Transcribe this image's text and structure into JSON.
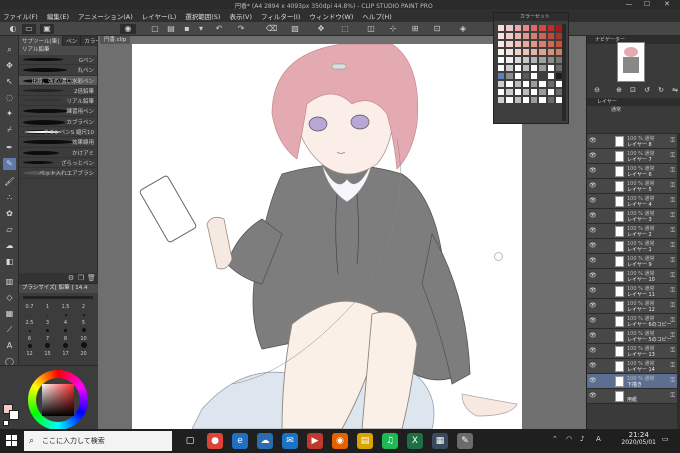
{
  "window": {
    "title": "円香* (A4 2894 x 4093px 350dpi 44.8%)  - CLIP STUDIO PAINT PRO",
    "minimize": "—",
    "maximize": "☐",
    "close": "✕"
  },
  "menu": [
    "ファイル(F)",
    "編集(E)",
    "アニメーション(A)",
    "レイヤー(L)",
    "選択範囲(S)",
    "表示(V)",
    "フィルター(I)",
    "ウィンドウ(W)",
    "ヘルプ(H)"
  ],
  "subtool": {
    "tabs": [
      "サブツール[筆]",
      "ペン",
      "カラー",
      "鉛筆"
    ],
    "header": "リアル鉛筆",
    "brushes": [
      {
        "name": "Gペン"
      },
      {
        "name": "丸ペン"
      },
      {
        "name": "出線、強め/濃い水彩ペン",
        "selected": true
      },
      {
        "name": "2倍鉛筆"
      },
      {
        "name": "リアル鉛筆"
      },
      {
        "name": "練習用ペン"
      },
      {
        "name": "カブラペン"
      },
      {
        "name": "ネオンペンS 縮尺10"
      },
      {
        "name": "効果線用"
      },
      {
        "name": "かけアミ"
      },
      {
        "name": "ざらっとペン"
      },
      {
        "name": "ペット入れエアブラシ"
      }
    ]
  },
  "brushsize": {
    "header": "ブラシサイズ[ 鉛筆 ] 14.4",
    "sizes": [
      "0.7",
      "1",
      "1.5",
      "2",
      "2.5",
      "3",
      "4",
      "5",
      "6",
      "7",
      "8",
      "10",
      "12",
      "15",
      "17",
      "20"
    ]
  },
  "canvas": {
    "doc_tab": "円香.clip"
  },
  "colorset": {
    "title": "カラーセット",
    "chips": [
      "#f6dede",
      "#f1c7c7",
      "#e9a9a9",
      "#e28c8c",
      "#d86a6a",
      "#cf4a4a",
      "#c42a2a",
      "#b01818",
      "#f4e3e0",
      "#eecdc8",
      "#e6b4ad",
      "#de9a92",
      "#d57f76",
      "#cc645a",
      "#c2493e",
      "#a9322a",
      "#f7e9e4",
      "#f2d6cf",
      "#ecc1b7",
      "#e5ac9f",
      "#de9686",
      "#d6806d",
      "#ce6a55",
      "#c4543c",
      "#fbf2ee",
      "#f7e4dc",
      "#f2d4c9",
      "#ecc4b5",
      "#e6b3a1",
      "#dfa28c",
      "#d89177",
      "#d08062",
      "#ffffff",
      "#f0f0f0",
      "#dcdcdc",
      "#c8c8c8",
      "#b4b4b4",
      "#a0a0a0",
      "#8c8c8c",
      "#787878",
      "#ffffff",
      "#cfcfcf",
      "#ffffff",
      "#bdbdbd",
      "#ffffff",
      "#9b9b9b",
      "#ffffff",
      "#6b6b6b",
      "#5d7fb3",
      "#8c8c8c",
      "#ffffff",
      "#5a5a5a",
      "#ffffff",
      "#3d3d3d",
      "#ffffff",
      "#1f1f1f",
      "#cfcfcf",
      "#ffffff",
      "#bdbdbd",
      "#ffffff",
      "#9b9b9b",
      "#ffffff",
      "#6b6b6b",
      "#ffffff",
      "#ffffff",
      "#cfcfcf",
      "#ffffff",
      "#bdbdbd",
      "#ffffff",
      "#9b9b9b",
      "#ffffff",
      "#6b6b6b",
      "#cfcfcf",
      "#ffffff",
      "#bdbdbd",
      "#ffffff",
      "#9b9b9b",
      "#ffffff",
      "#6b6b6b",
      "#ffffff"
    ]
  },
  "rightpanel": {
    "nav_tab": "ナビゲーター",
    "layer_tab": "レイヤー",
    "blend": "通常",
    "opacity": "100"
  },
  "layers": [
    {
      "blend": "100 % 通常",
      "name": "レイヤー 8"
    },
    {
      "blend": "100 % 通常",
      "name": "レイヤー 7"
    },
    {
      "blend": "100 % 通常",
      "name": "レイヤー 6"
    },
    {
      "blend": "100 % 通常",
      "name": "レイヤー 5"
    },
    {
      "blend": "100 % 通常",
      "name": "レイヤー 4"
    },
    {
      "blend": "100 % 通常",
      "name": "レイヤー 3"
    },
    {
      "blend": "100 % 通常",
      "name": "レイヤー 2"
    },
    {
      "blend": "100 % 通常",
      "name": "レイヤー 1"
    },
    {
      "blend": "100 % 通常",
      "name": "レイヤー 9"
    },
    {
      "blend": "100 % 通常",
      "name": "レイヤー 10"
    },
    {
      "blend": "100 % 通常",
      "name": "レイヤー 11"
    },
    {
      "blend": "100 % 通常",
      "name": "レイヤー 12"
    },
    {
      "blend": "100 % 通常",
      "name": "レイヤー 6のコピー"
    },
    {
      "blend": "100 % 通常",
      "name": "レイヤー 5のコピー"
    },
    {
      "blend": "100 % 通常",
      "name": "レイヤー 13"
    },
    {
      "blend": "100 % 通常",
      "name": "レイヤー 14"
    },
    {
      "blend": "100 % 通常",
      "name": "下描き",
      "selected": true
    },
    {
      "blend": "",
      "name": "用紙"
    }
  ],
  "taskbar": {
    "search_placeholder": "ここに入力して検索",
    "time": "21:24",
    "date": "2020/05/01",
    "apps": [
      {
        "icon": "task-view-icon",
        "glyph": "▢",
        "color": "#1f1f1f"
      },
      {
        "icon": "chrome-icon",
        "glyph": "●",
        "color": "#db4437"
      },
      {
        "icon": "edge-icon",
        "glyph": "e",
        "color": "#1f6fc5"
      },
      {
        "icon": "onedrive-icon",
        "glyph": "☁",
        "color": "#2b6cb0"
      },
      {
        "icon": "mail-icon",
        "glyph": "✉",
        "color": "#1a73c7"
      },
      {
        "icon": "media-icon",
        "glyph": "▶",
        "color": "#c0392b"
      },
      {
        "icon": "firefox-icon",
        "glyph": "◉",
        "color": "#e66000"
      },
      {
        "icon": "folder-icon",
        "glyph": "▤",
        "color": "#d9a400"
      },
      {
        "icon": "spotify-icon",
        "glyph": "♫",
        "color": "#1db954"
      },
      {
        "icon": "excel-icon",
        "glyph": "X",
        "color": "#1d7044"
      },
      {
        "icon": "store-icon",
        "glyph": "▦",
        "color": "#3a4a5a"
      },
      {
        "icon": "clip-studio-icon",
        "glyph": "✎",
        "color": "#6b6b6b"
      }
    ]
  }
}
